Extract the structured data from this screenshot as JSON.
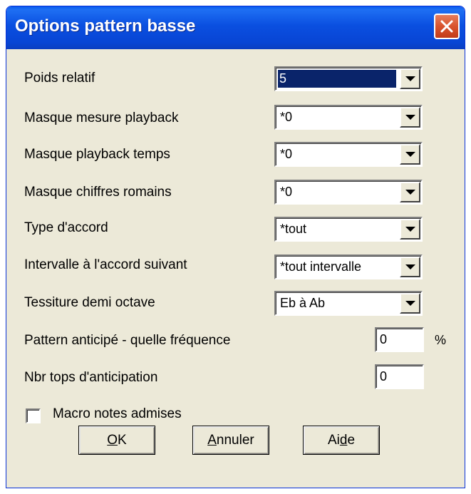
{
  "window": {
    "title": "Options pattern basse"
  },
  "fields": [
    {
      "label": "Poids relatif",
      "value": "5"
    },
    {
      "label": "Masque mesure playback",
      "value": "*0"
    },
    {
      "label": "Masque playback temps",
      "value": "*0"
    },
    {
      "label": "Masque chiffres romains",
      "value": "*0"
    },
    {
      "label": "Type d'accord",
      "value": "*tout"
    },
    {
      "label": "Intervalle à l'accord suivant",
      "value": "*tout intervalle"
    },
    {
      "label": "Tessiture demi octave",
      "value": "Eb à Ab"
    }
  ],
  "anticipation_frequency": {
    "label": "Pattern anticipé - quelle fréquence",
    "value": "0",
    "unit": "%"
  },
  "anticipation_ticks": {
    "label": "Nbr tops d'anticipation",
    "value": "0"
  },
  "macro_notes": {
    "label": "Macro notes admises",
    "checked": false
  },
  "buttons": {
    "ok_mnemonic": "O",
    "ok_rest": "K",
    "cancel_mnemonic": "A",
    "cancel_rest": "nnuler",
    "help_start": "Ai",
    "help_mnemonic": "d",
    "help_rest": "e"
  },
  "icons": {
    "close": "close-icon",
    "dropdown": "chevron-down-icon"
  },
  "colors": {
    "titlebar": "#0a4fe0",
    "dialog_bg": "#ece9d8",
    "close_button": "#d9532d",
    "selection": "#0a246a"
  }
}
